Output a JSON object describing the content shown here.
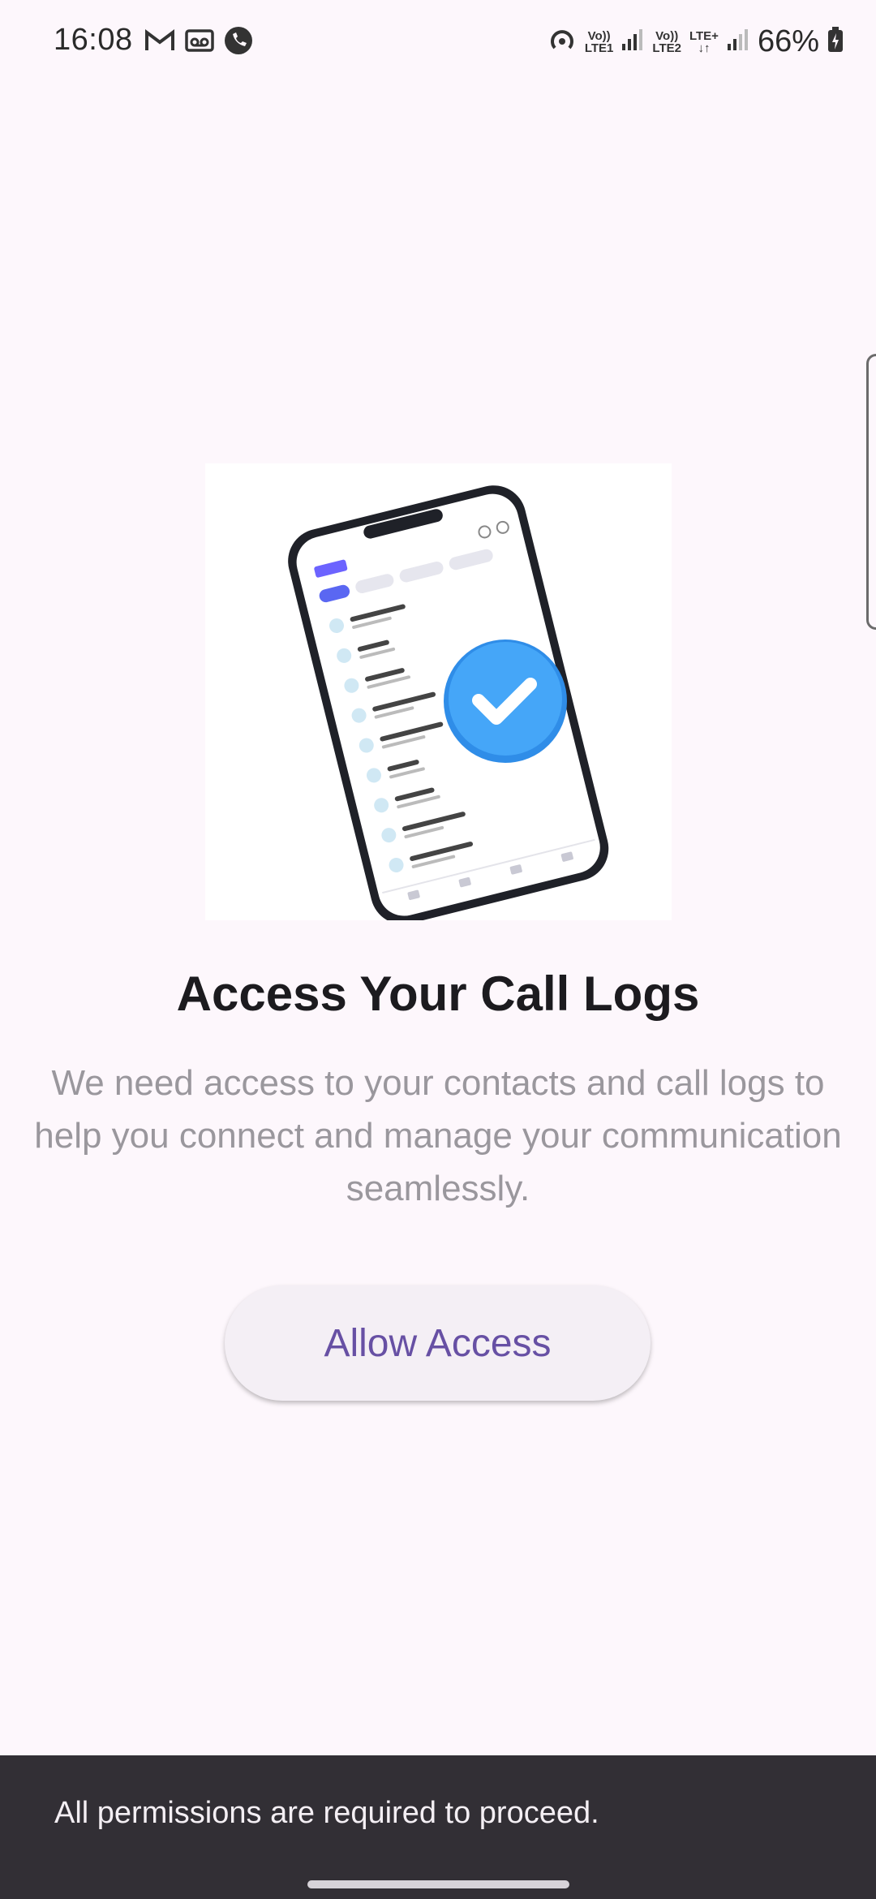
{
  "status_bar": {
    "time": "16:08",
    "battery": "66%",
    "sim1_label_top": "Vo))",
    "sim1_label_bottom": "LTE1",
    "sim2_label_top": "Vo))",
    "sim2_label_bottom": "LTE2",
    "network_type": "LTE+"
  },
  "main": {
    "title": "Access Your Call Logs",
    "description": "We need access to your contacts and call logs to help you connect and manage your communication seamlessly.",
    "allow_button_label": "Allow Access"
  },
  "snackbar": {
    "message": "All permissions are required to proceed."
  },
  "colors": {
    "background": "#fdf7fc",
    "accent": "#6750a4",
    "snackbar_bg": "#322f35",
    "check_badge": "#3a9cf5"
  }
}
